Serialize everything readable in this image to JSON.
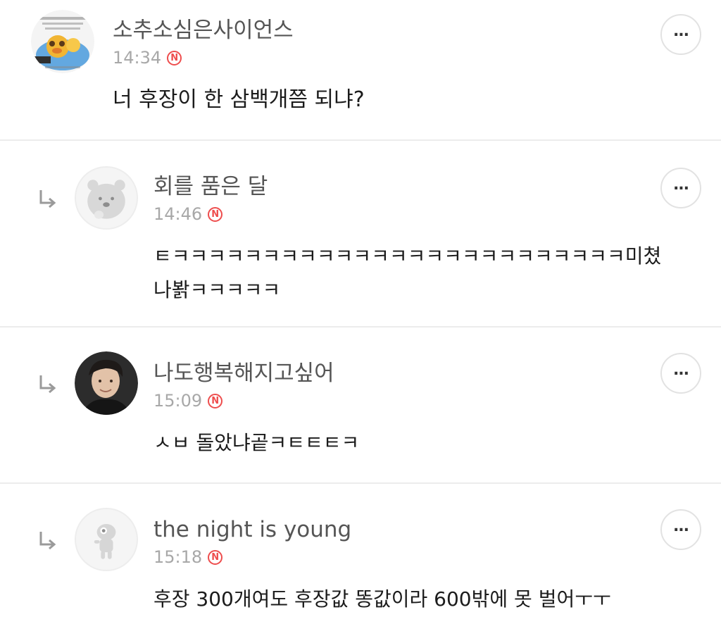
{
  "comments": [
    {
      "author": "소추소심은사이언스",
      "time": "14:34",
      "badge": "N",
      "text": "너 후장이 한 삼백개쯤 되냐?",
      "is_reply": false,
      "avatar_icon": "character-sticker-avatar"
    },
    {
      "author": "회를 품은 달",
      "time": "14:46",
      "badge": "N",
      "text": "ㅌㅋㅋㅋㅋㅋㅋㅋㅋㅋㅋㅋㅋㅋㅋㅋㅋㅋㅋㅋㅋㅋㅋㅋㅋㅋ미쳤\n나봙ㅋㅋㅋㅋㅋ",
      "is_reply": true,
      "avatar_icon": "default-bear-avatar"
    },
    {
      "author": "나도행복해지고싶어",
      "time": "15:09",
      "badge": "N",
      "text": "ㅅㅂ 돌았냐곹ㅋㅌㅌㅌㅋ",
      "is_reply": true,
      "avatar_icon": "photo-avatar"
    },
    {
      "author": "the night is young",
      "time": "15:18",
      "badge": "N",
      "text": "후장 300개여도 후장값 똥값이라 600밖에 못 벌어ㅜㅜ",
      "is_reply": true,
      "avatar_icon": "default-character-avatar"
    }
  ],
  "more_label": "...",
  "colors": {
    "badge": "#ee4d4d",
    "author": "#555555",
    "time": "#a8a8a8",
    "divider": "#ececec"
  }
}
